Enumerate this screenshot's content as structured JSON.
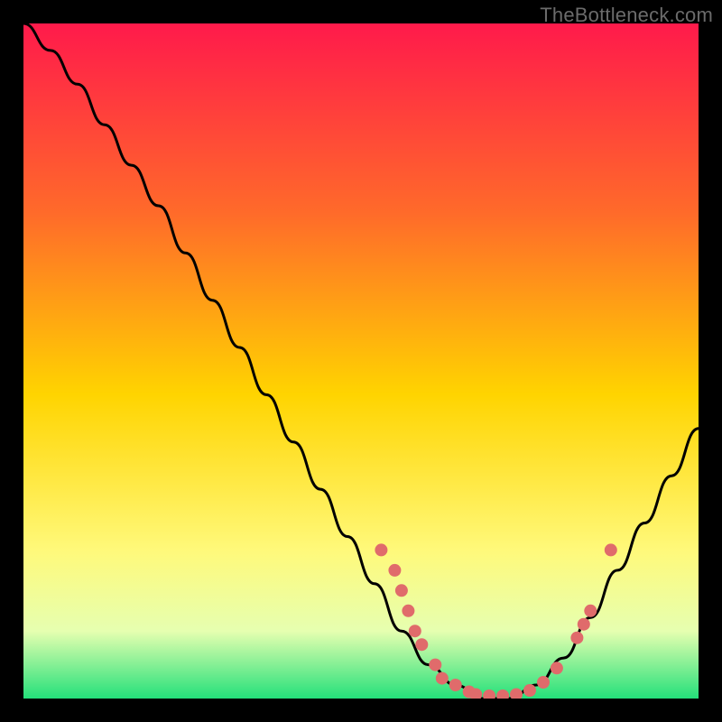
{
  "watermark": "TheBottleneck.com",
  "colors": {
    "background": "#000000",
    "gradient_top": "#ff1a4b",
    "gradient_mid1": "#ff7f2a",
    "gradient_mid2": "#ffd400",
    "gradient_mid3": "#fff97a",
    "gradient_bottom": "#24e07a",
    "curve": "#000000",
    "points": "#e06b6b",
    "watermark": "#6b6b6b"
  },
  "chart_data": {
    "type": "line",
    "title": "",
    "xlabel": "",
    "ylabel": "",
    "xlim": [
      0,
      100
    ],
    "ylim": [
      0,
      100
    ],
    "series": [
      {
        "name": "bottleneck-curve",
        "x": [
          0,
          4,
          8,
          12,
          16,
          20,
          24,
          28,
          32,
          36,
          40,
          44,
          48,
          52,
          56,
          60,
          64,
          68,
          72,
          76,
          80,
          84,
          88,
          92,
          96,
          100
        ],
        "y": [
          100,
          96,
          91,
          85,
          79,
          73,
          66,
          59,
          52,
          45,
          38,
          31,
          24,
          17,
          10,
          5,
          2,
          0,
          0,
          2,
          6,
          12,
          19,
          26,
          33,
          40
        ]
      }
    ],
    "points": [
      {
        "x": 53,
        "y": 22
      },
      {
        "x": 55,
        "y": 19
      },
      {
        "x": 56,
        "y": 16
      },
      {
        "x": 57,
        "y": 13
      },
      {
        "x": 58,
        "y": 10
      },
      {
        "x": 59,
        "y": 8
      },
      {
        "x": 61,
        "y": 5
      },
      {
        "x": 62,
        "y": 3
      },
      {
        "x": 64,
        "y": 2
      },
      {
        "x": 66,
        "y": 1
      },
      {
        "x": 67,
        "y": 0.6
      },
      {
        "x": 69,
        "y": 0.4
      },
      {
        "x": 71,
        "y": 0.4
      },
      {
        "x": 73,
        "y": 0.6
      },
      {
        "x": 75,
        "y": 1.2
      },
      {
        "x": 77,
        "y": 2.4
      },
      {
        "x": 79,
        "y": 4.5
      },
      {
        "x": 82,
        "y": 9
      },
      {
        "x": 83,
        "y": 11
      },
      {
        "x": 84,
        "y": 13
      },
      {
        "x": 87,
        "y": 22
      }
    ]
  }
}
